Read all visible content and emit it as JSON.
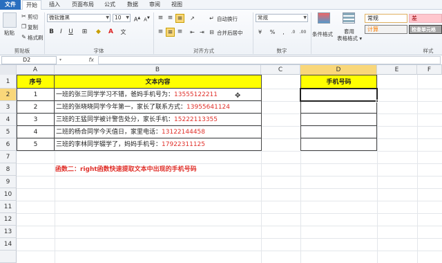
{
  "tabs": [
    "文件",
    "开始",
    "插入",
    "页面布局",
    "公式",
    "数据",
    "审阅",
    "视图"
  ],
  "clipboard": {
    "paste": "粘贴",
    "cut": "剪切",
    "copy": "复制",
    "format_painter": "格式刷",
    "label": "剪贴板"
  },
  "font": {
    "name": "微软雅黑",
    "size": "10",
    "label": "字体"
  },
  "alignment": {
    "wrap": "自动换行",
    "merge": "合并后居中",
    "label": "对齐方式"
  },
  "number": {
    "format": "常规",
    "label": "数字"
  },
  "styles": {
    "cond_format": "条件格式",
    "table_format": "套用\n表格格式",
    "s1": "常规",
    "s2": "差",
    "s3": "计算",
    "s4": "检查单元格",
    "label": "样式"
  },
  "namebox": "D2",
  "fx": "fx",
  "columns": [
    "A",
    "B",
    "C",
    "D",
    "E",
    "F"
  ],
  "rows": [
    "1",
    "2",
    "3",
    "4",
    "5",
    "6",
    "7",
    "8",
    "9",
    "10",
    "11",
    "12",
    "13",
    "14"
  ],
  "header": {
    "seq": "序号",
    "text": "文本内容",
    "phone": "手机号码"
  },
  "data": [
    {
      "seq": "1",
      "text": "一班的张三同学学习不错，爸妈手机号为：",
      "phone": "13555122211"
    },
    {
      "seq": "2",
      "text": "二班的张晓晓同学今年第一，家长了联系方式：",
      "phone": "13955641124"
    },
    {
      "seq": "3",
      "text": "三班的王猛同学被计警告处分，家长手机：",
      "phone": "15222113355"
    },
    {
      "seq": "4",
      "text": "二班的杨合同学今天值日，家里电话：",
      "phone": "13122144458"
    },
    {
      "seq": "5",
      "text": "三班的李林同学辍学了，妈妈手机号：",
      "phone": "17922311125"
    }
  ],
  "note": "函数二：right函数快速提取文本中出现的手机号码",
  "colors": {
    "header_fill": "#ffff00",
    "phone_text": "#e0302a",
    "select_hdr": "#f9d77a",
    "file_tab": "#2a6fbf"
  }
}
